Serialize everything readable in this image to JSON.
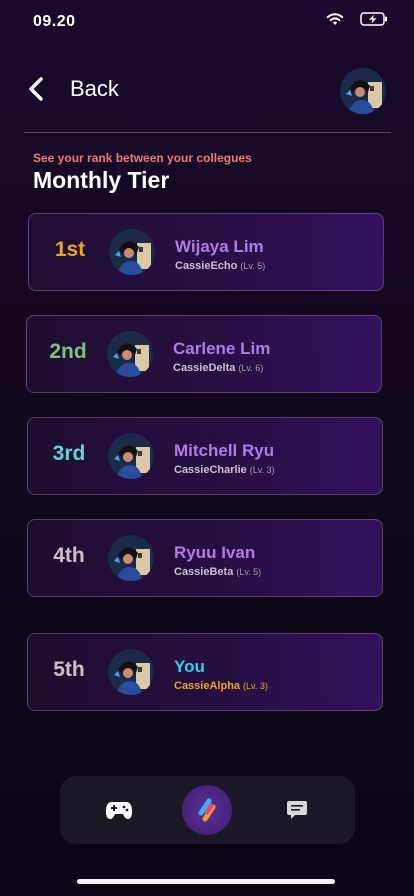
{
  "status_bar": {
    "time": "09.20"
  },
  "header": {
    "back_label": "Back"
  },
  "subtitle": "See your rank between your collegues",
  "title": "Monthly Tier",
  "ranks": [
    {
      "rank": "1st",
      "name": "Wijaya Lim",
      "username": "CassieEcho",
      "level": "(Lv. 5)",
      "rank_color": "#e8a628",
      "name_color": "#b07ce8",
      "username_color": "#c9c3d1"
    },
    {
      "rank": "2nd",
      "name": "Carlene Lim",
      "username": "CassieDelta",
      "level": "(Lv. 6)",
      "rank_color": "#7cc575",
      "name_color": "#b07ce8",
      "username_color": "#c9c3d1"
    },
    {
      "rank": "3rd",
      "name": "Mitchell Ryu",
      "username": "CassieCharlie",
      "level": "(Lv. 3)",
      "rank_color": "#5fd6d8",
      "name_color": "#b07ce8",
      "username_color": "#c9c3d1"
    },
    {
      "rank": "4th",
      "name": "Ryuu Ivan",
      "username": "CassieBeta",
      "level": "(Lv. 5)",
      "rank_color": "#c7c2cc",
      "name_color": "#b07ce8",
      "username_color": "#c9c3d1"
    },
    {
      "rank": "5th",
      "name": "You",
      "username": "CassieAlpha",
      "level": "(Lv. 3)",
      "rank_color": "#c7c2cc",
      "name_color": "#2fd3e6",
      "username_color": "#e8a628"
    }
  ],
  "nav": {
    "items": [
      "game-controller-icon",
      "app-logo-icon",
      "chat-icon"
    ]
  },
  "colors": {
    "accent_purple": "#b07ce8",
    "subtitle_red": "#ef7a76"
  }
}
